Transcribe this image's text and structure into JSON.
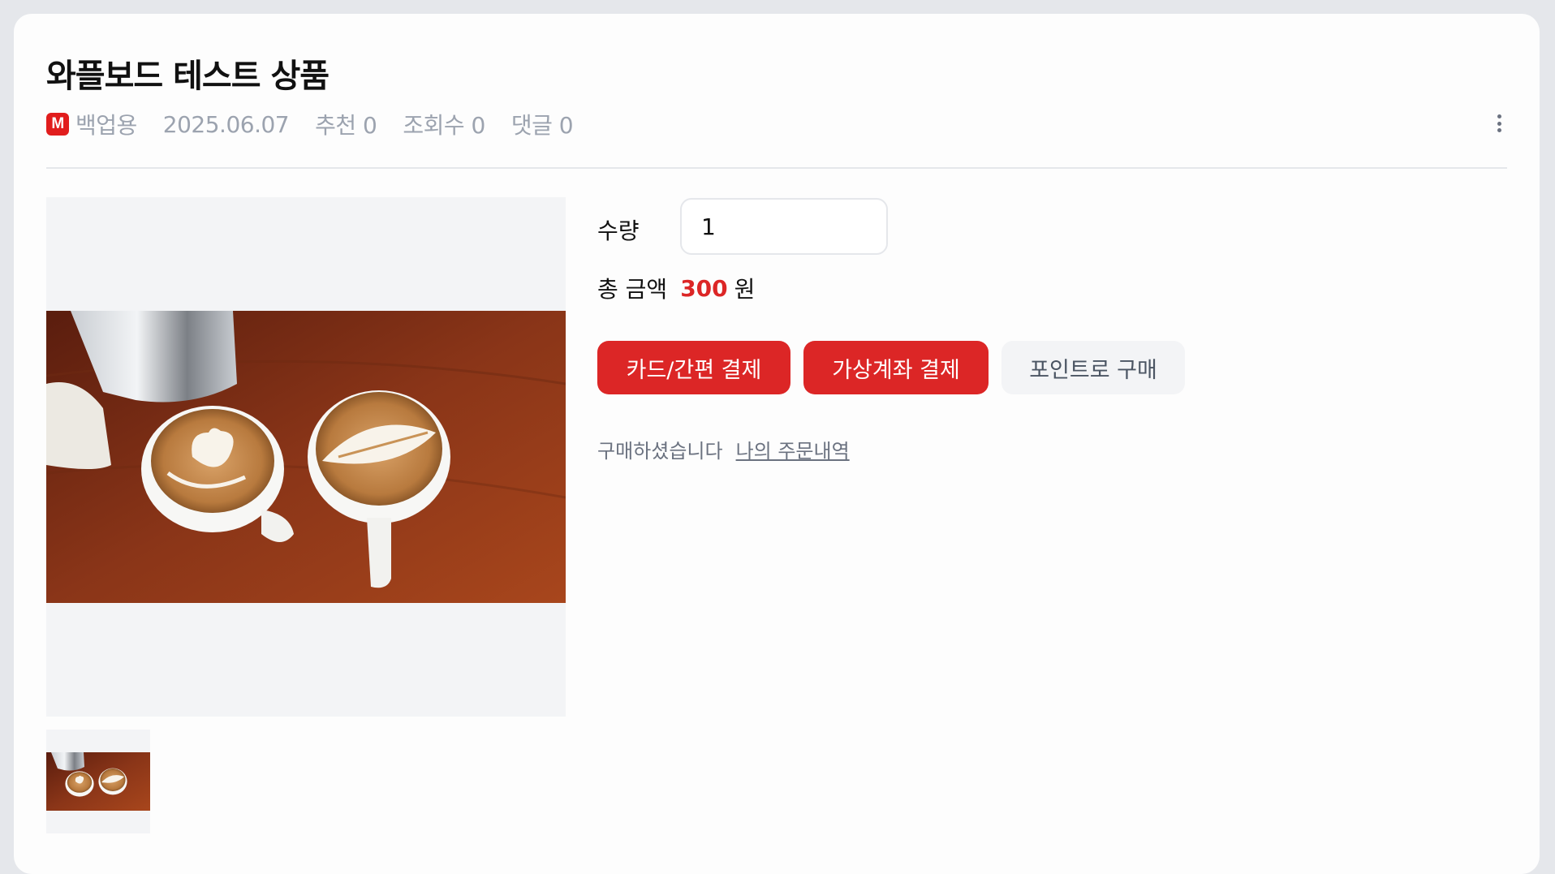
{
  "post": {
    "title": "와플보드 테스트 상품",
    "badge": "M",
    "author": "백업용",
    "date": "2025.06.07",
    "recommend": "추천 0",
    "views": "조회수 0",
    "comments": "댓글 0"
  },
  "product": {
    "quantity_label": "수량",
    "quantity_value": "1",
    "total_label": "총 금액",
    "total_amount": "300",
    "currency": "원"
  },
  "buttons": {
    "card_pay": "카드/간편 결제",
    "virtual_account": "가상계좌 결제",
    "point_buy": "포인트로 구매"
  },
  "purchase_status": {
    "message": "구매하셨습니다",
    "link": "나의 주문내역"
  },
  "colors": {
    "accent": "#dc2626",
    "badge": "#e11d1d",
    "muted": "#9ca3af"
  }
}
